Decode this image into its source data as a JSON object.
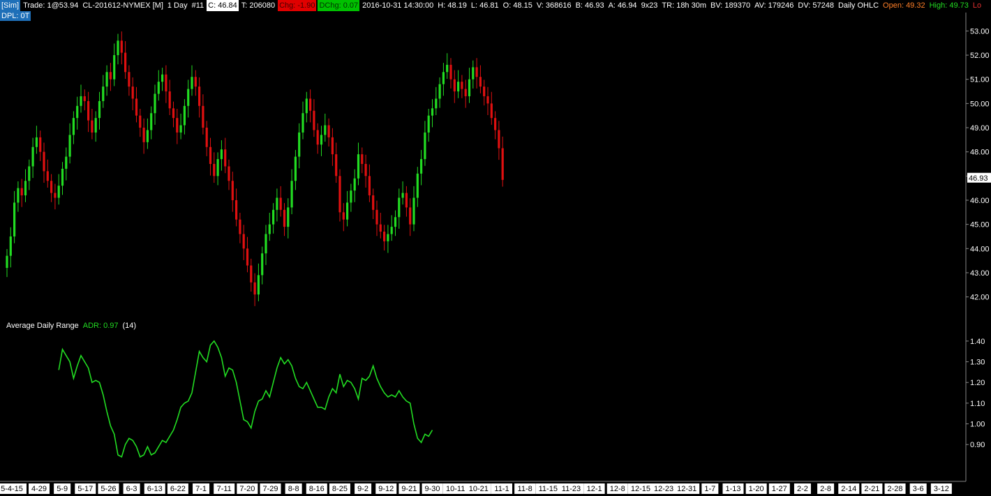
{
  "header": {
    "sim": "[Sim]",
    "trade": "Trade: 1@53.94",
    "symbol": "CL-201612-NYMEX [M]",
    "interval": "1 Day",
    "bar": "#11",
    "close": "C: 46.84",
    "ticks": "T: 206080",
    "chg": "Chg: -1.90",
    "dchg": "DChg: 0.07",
    "datetime": "2016-10-31 14:30:00",
    "high": "H: 48.19",
    "low": "L: 46.81",
    "open": "O: 48.15",
    "volume": "V: 368616",
    "bid": "B: 46.93",
    "ask": "A: 46.94",
    "size": "9x23",
    "time_remaining": "TR: 18h 30m",
    "bid_volume": "BV: 189370",
    "ask_volume": "AV: 179246",
    "delta_volume": "DV: 57248",
    "chart_style": "Daily OHLC",
    "open_label": "Open: 49.32",
    "high_label": "High: 49.73",
    "low_label": "Lo"
  },
  "dpl": "DPL: 0T",
  "colors": {
    "up": "#22dd22",
    "down": "#e01010",
    "adr_line": "#22dd22",
    "background": "#000000",
    "sim_box": "#1e6fb8",
    "open_text": "#ff7f27"
  },
  "chart_data": [
    {
      "type": "candlestick",
      "ylim": [
        41.7,
        53.3
      ],
      "y_ticks": [
        "53.00",
        "52.00",
        "51.00",
        "50.00",
        "49.00",
        "48.00",
        "47.00",
        "46.00",
        "45.00",
        "44.00",
        "43.00",
        "42.00"
      ],
      "last_price_label": "46.93",
      "x_tick_labels": [
        "5-4-15",
        "4-29",
        "5-9",
        "5-17",
        "5-26",
        "6-3",
        "6-13",
        "6-22",
        "7-1",
        "7-11",
        "7-20",
        "7-29",
        "8-8",
        "8-16",
        "8-25",
        "9-2",
        "9-12",
        "9-21",
        "9-30",
        "10-11",
        "10-21",
        "11-1",
        "11-8",
        "11-15",
        "11-23",
        "12-1",
        "12-8",
        "12-15",
        "12-23",
        "12-31",
        "1-7",
        "1-13",
        "1-20",
        "1-27",
        "2-2",
        "2-8",
        "2-14",
        "2-21",
        "2-28",
        "3-6",
        "3-12"
      ],
      "closes": [
        43.7,
        44.5,
        45.9,
        46.5,
        46.2,
        46.8,
        47.4,
        48.2,
        48.6,
        48.0,
        47.2,
        46.8,
        46.3,
        46.1,
        46.6,
        47.3,
        47.8,
        48.7,
        49.4,
        49.9,
        50.3,
        50.1,
        49.3,
        48.8,
        49.4,
        50.1,
        50.7,
        51.3,
        51.0,
        52.0,
        52.6,
        52.1,
        51.3,
        50.7,
        50.2,
        49.5,
        49.0,
        48.4,
        48.9,
        49.6,
        50.4,
        50.9,
        51.2,
        50.5,
        49.8,
        49.4,
        48.8,
        49.1,
        49.9,
        50.6,
        51.1,
        50.7,
        49.9,
        49.0,
        48.2,
        47.5,
        47.0,
        47.7,
        48.1,
        47.4,
        46.8,
        46.0,
        45.2,
        44.6,
        44.0,
        43.3,
        42.6,
        42.1,
        42.9,
        43.8,
        44.6,
        45.0,
        45.6,
        46.1,
        45.6,
        44.9,
        45.7,
        46.8,
        47.8,
        48.8,
        49.6,
        50.2,
        49.7,
        48.9,
        48.3,
        48.7,
        49.1,
        48.6,
        47.9,
        47.0,
        45.5,
        45.2,
        45.9,
        46.4,
        46.9,
        47.9,
        47.5,
        47.0,
        46.2,
        45.6,
        45.0,
        44.7,
        44.3,
        44.6,
        44.9,
        45.3,
        46.1,
        46.3,
        45.7,
        45.0,
        46.1,
        47.1,
        47.7,
        48.8,
        49.5,
        49.8,
        50.2,
        50.8,
        51.3,
        51.6,
        51.0,
        50.5,
        50.9,
        50.6,
        50.3,
        51.0,
        51.5,
        51.1,
        50.7,
        50.3,
        50.0,
        49.4,
        48.9,
        48.15,
        46.84
      ]
    },
    {
      "type": "line",
      "title": "Average Daily Range",
      "value_label": "ADR: 0.97",
      "period_label": "(14)",
      "ylim": [
        0.83,
        1.43
      ],
      "y_ticks": [
        "1.40",
        "1.30",
        "1.20",
        "1.10",
        "1.00",
        "0.90"
      ],
      "start_index": 14,
      "values": [
        1.26,
        1.36,
        1.33,
        1.3,
        1.22,
        1.28,
        1.33,
        1.3,
        1.27,
        1.2,
        1.21,
        1.2,
        1.14,
        1.06,
        0.99,
        0.95,
        0.85,
        0.84,
        0.9,
        0.93,
        0.92,
        0.89,
        0.84,
        0.85,
        0.89,
        0.85,
        0.86,
        0.89,
        0.92,
        0.91,
        0.94,
        0.97,
        1.02,
        1.08,
        1.1,
        1.11,
        1.15,
        1.25,
        1.35,
        1.32,
        1.3,
        1.38,
        1.4,
        1.37,
        1.32,
        1.23,
        1.27,
        1.26,
        1.2,
        1.11,
        1.02,
        1.01,
        0.98,
        1.06,
        1.11,
        1.12,
        1.16,
        1.13,
        1.2,
        1.27,
        1.32,
        1.29,
        1.31,
        1.28,
        1.22,
        1.18,
        1.17,
        1.2,
        1.16,
        1.12,
        1.08,
        1.08,
        1.07,
        1.13,
        1.17,
        1.15,
        1.24,
        1.18,
        1.21,
        1.2,
        1.17,
        1.12,
        1.22,
        1.21,
        1.23,
        1.28,
        1.22,
        1.18,
        1.15,
        1.13,
        1.14,
        1.13,
        1.16,
        1.13,
        1.11,
        1.1,
        1.0,
        0.93,
        0.91,
        0.95,
        0.94,
        0.97
      ]
    }
  ]
}
